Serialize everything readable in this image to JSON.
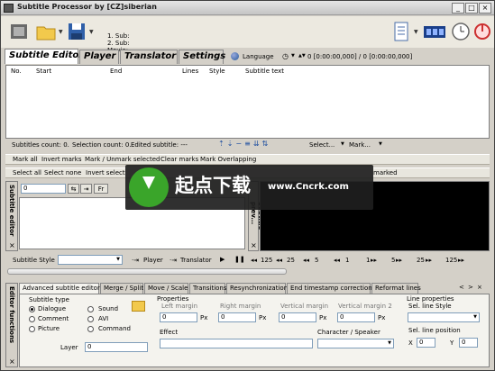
{
  "window": {
    "title": "Subtitle Processor by [CZ]siberian"
  },
  "toolbar": {
    "sub1": "1. Sub:",
    "sub2": "2. Sub:",
    "movie": "Movie:"
  },
  "main_tabs": [
    "Subtitle Editor",
    "Player",
    "Translator",
    "Settings"
  ],
  "language": {
    "label": "Language",
    "time": "0 [0:00:00,000] / 0 [0:00:00,000]"
  },
  "grid": {
    "columns": [
      "No.",
      "Start",
      "End",
      "Lines",
      "Style",
      "Subtitle text"
    ]
  },
  "status": {
    "subtitles": "Subtitles count: 0.",
    "selection": "Selection count: 0.",
    "edited": "Edited subtitle: ---",
    "select": "Select...",
    "mark": "Mark..."
  },
  "mark_bar": [
    "Mark all",
    "Invert marks",
    "Mark / Unmark selected",
    "Clear marks",
    "Mark Overlapping"
  ],
  "select_bar": [
    "Select all",
    "Select none",
    "Invert select",
    "marked"
  ],
  "editor": {
    "side_title": "Subtitle editor",
    "frame_value": "0",
    "fr_label": "Fr",
    "preview_label": "Subtitle prev..."
  },
  "playback": {
    "style_label": "Subtitle Style",
    "player": "Player",
    "translator": "Translator",
    "steps": [
      "125",
      "25",
      "5",
      "1",
      "1",
      "5",
      "25",
      "125"
    ]
  },
  "ef_tabs": [
    "Advanced subtitle editor",
    "Merge / Split",
    "Move / Scale",
    "Transitions",
    "Resynchronization",
    "End timestamp corrections",
    "Reformat lines"
  ],
  "ef": {
    "side_title": "Editor functions",
    "subtitle_type": "Subtitle type",
    "types": [
      "Dialogue",
      "Comment",
      "Picture",
      "Sound",
      "AVI",
      "Command"
    ],
    "properties": "Properties",
    "left_margin": "Left margin",
    "right_margin": "Right margin",
    "vertical_margin": "Vertical margin",
    "vertical_margin2": "Vertical margin 2",
    "margin_value": "0",
    "px": "Px",
    "line_properties": "Line properties",
    "sel_line_style": "Sel. line Style",
    "sel_line_position": "Sel. line position",
    "x": "X",
    "y": "Y",
    "pos_x": "0",
    "pos_y": "0",
    "layer": "Layer",
    "layer_value": "0",
    "effect": "Effect",
    "character": "Character / Speaker"
  },
  "watermark": {
    "brand": "起点下载",
    "url": "www.Cncrk.com"
  }
}
